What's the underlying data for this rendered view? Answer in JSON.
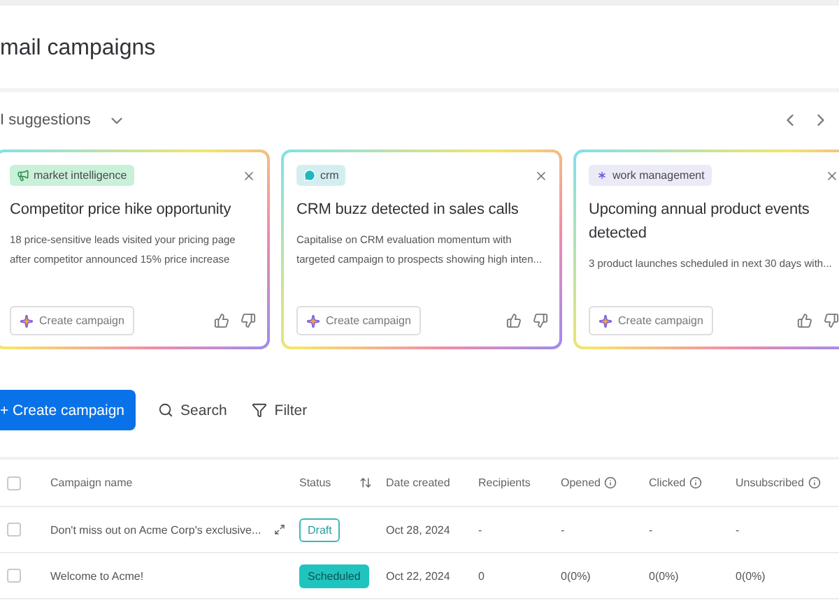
{
  "page": {
    "title": "mail campaigns"
  },
  "suggestions": {
    "label": "I suggestions",
    "expanded": true,
    "cards": [
      {
        "tag": {
          "label": "market intelligence",
          "kind": "megaphone",
          "color": "#c9f0d8"
        },
        "title": "Competitor price hike opportunity",
        "description": "18 price-sensitive leads visited your pricing page after competitor announced 15% price increase",
        "action": "Create campaign"
      },
      {
        "tag": {
          "label": "crm",
          "kind": "chat",
          "color": "#d3eef0"
        },
        "title": "CRM buzz detected in sales calls",
        "description": "Capitalise on CRM evaluation momentum with targeted campaign to prospects showing high inten...",
        "action": "Create campaign"
      },
      {
        "tag": {
          "label": "work management",
          "kind": "asterisk",
          "color": "#ebeaf7"
        },
        "title": "Upcoming annual product events detected",
        "description": "3 product launches scheduled in next 30 days with...",
        "action": "Create campaign"
      }
    ]
  },
  "toolbar": {
    "create": "+ Create campaign",
    "search": "Search",
    "filter": "Filter"
  },
  "table": {
    "header_checked": false,
    "columns": [
      {
        "label": "Campaign name"
      },
      {
        "label": "Status",
        "sortable": true
      },
      {
        "label": "Date created"
      },
      {
        "label": "Recipients"
      },
      {
        "label": "Opened",
        "info": true
      },
      {
        "label": "Clicked",
        "info": true
      },
      {
        "label": "Unsubscribed",
        "info": true
      }
    ],
    "rows": [
      {
        "checked": false,
        "name": "Don't miss out on Acme Corp's exclusive...",
        "expandable": true,
        "status": {
          "label": "Draft",
          "kind": "draft"
        },
        "date": "Oct 28, 2024",
        "recipients": "-",
        "opened": "-",
        "clicked": "-",
        "unsubscribed": "-"
      },
      {
        "checked": false,
        "name": "Welcome to Acme!",
        "expandable": false,
        "status": {
          "label": "Scheduled",
          "kind": "scheduled"
        },
        "date": "Oct 22, 2024",
        "recipients": "0",
        "opened": "0(0%)",
        "clicked": "0(0%)",
        "unsubscribed": "0(0%)"
      }
    ]
  }
}
